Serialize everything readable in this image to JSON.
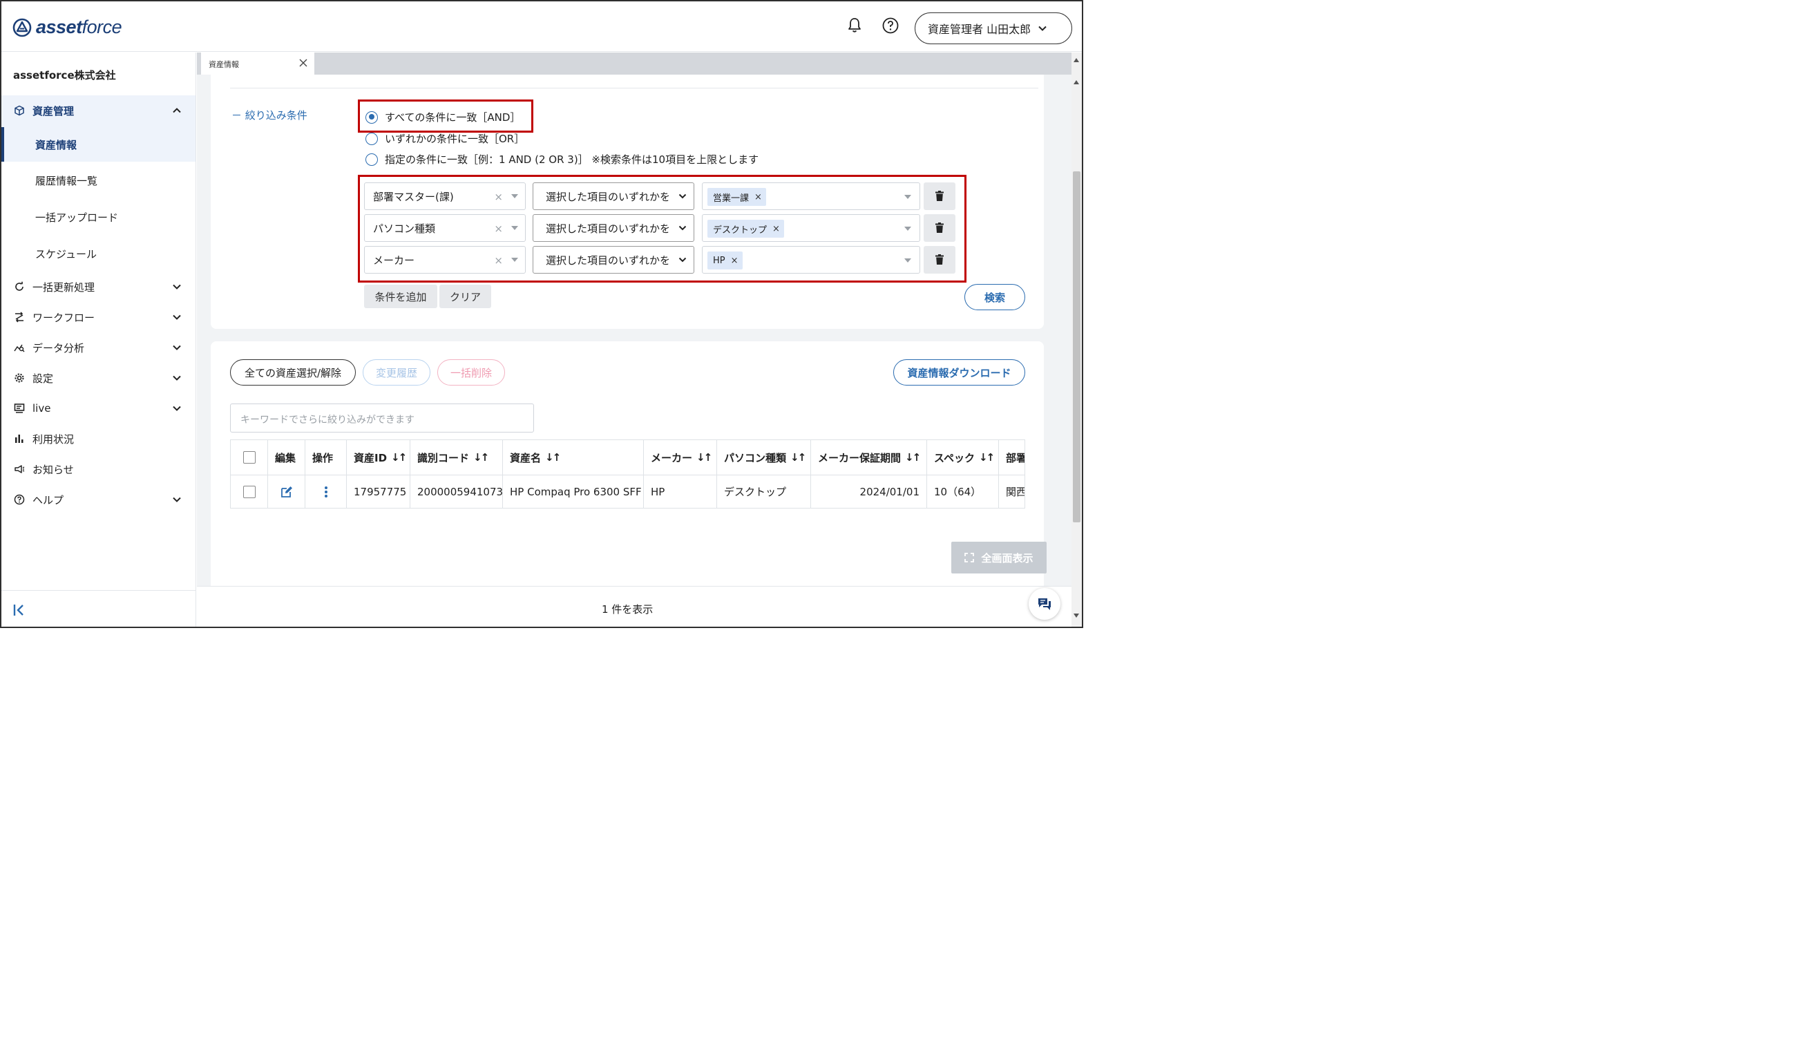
{
  "header": {
    "logo_bold": "asset",
    "logo_light": "force",
    "user_label": "資産管理者 山田太郎"
  },
  "sidebar": {
    "company": "assetforce株式会社",
    "group_label": "資産管理",
    "sub_items": [
      {
        "label": "資産情報"
      },
      {
        "label": "履歴情報一覧"
      },
      {
        "label": "一括アップロード"
      },
      {
        "label": "スケジュール"
      }
    ],
    "items": [
      {
        "label": "一括更新処理",
        "icon": "refresh-icon"
      },
      {
        "label": "ワークフロー",
        "icon": "workflow-icon"
      },
      {
        "label": "データ分析",
        "icon": "analytics-icon"
      },
      {
        "label": "設定",
        "icon": "gear-icon"
      },
      {
        "label": "live",
        "icon": "live-icon"
      },
      {
        "label": "利用状況",
        "icon": "bar-chart-icon"
      },
      {
        "label": "お知らせ",
        "icon": "megaphone-icon"
      },
      {
        "label": "ヘルプ",
        "icon": "help-icon"
      }
    ]
  },
  "tab": {
    "label": "資産情報"
  },
  "filter": {
    "toggle_label": "－ 絞り込み条件",
    "radios": [
      {
        "label": "すべての条件に一致［AND］",
        "selected": true
      },
      {
        "label": "いずれかの条件に一致［OR］",
        "selected": false
      },
      {
        "label": "指定の条件に一致［例：1 AND (2 OR 3)］ ※検索条件は10項目を上限とします",
        "selected": false
      }
    ],
    "conditions": [
      {
        "field": "部署マスター(課)",
        "operator": "選択した項目のいずれかを",
        "value": "営業一課"
      },
      {
        "field": "パソコン種類",
        "operator": "選択した項目のいずれかを",
        "value": "デスクトップ"
      },
      {
        "field": "メーカー",
        "operator": "選択した項目のいずれかを",
        "value": "HP"
      }
    ],
    "add_label": "条件を追加",
    "clear_label": "クリア",
    "search_label": "検索",
    "clear_glyph": "×"
  },
  "list": {
    "select_all_label": "全ての資産選択/解除",
    "history_label": "変更履歴",
    "bulk_delete_label": "一括削除",
    "download_label": "資産情報ダウンロード",
    "search_placeholder": "キーワードでさらに絞り込みができます",
    "sort_glyph": "↓↑",
    "columns": [
      "編集",
      "操作",
      "資産ID",
      "識別コード",
      "資産名",
      "メーカー",
      "パソコン種類",
      "メーカー保証期間",
      "スペック",
      "部署"
    ],
    "rows": [
      {
        "asset_id": "17957775",
        "code": "2000005941073",
        "name": "HP Compaq Pro 6300 SFF",
        "maker": "HP",
        "pc_type": "デスクトップ",
        "warranty": "2024/01/01",
        "spec": "10（64）",
        "dept": "関西"
      }
    ],
    "fullscreen_label": "全画面表示",
    "count_label": "1 件を表示"
  },
  "colors": {
    "brand": "#1c3f77",
    "accent": "#2b6cb0",
    "highlight": "#c00000",
    "delete": "#e06c8a"
  }
}
